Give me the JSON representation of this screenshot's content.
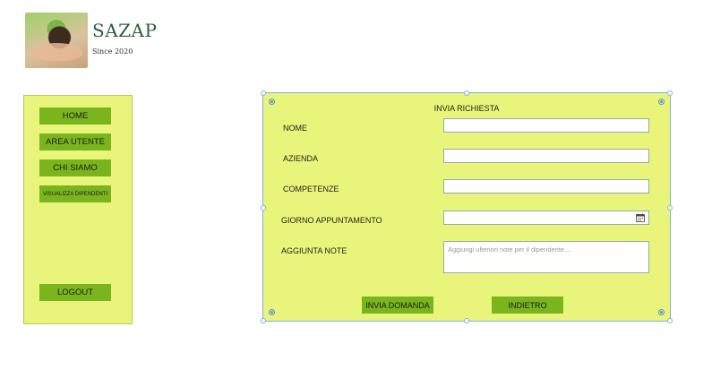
{
  "brand": {
    "name": "SAZAP",
    "since": "Since 2020"
  },
  "sidebar": {
    "items": [
      {
        "label": "HOME"
      },
      {
        "label": "AREA UTENTE"
      },
      {
        "label": "CHI SIAMO"
      },
      {
        "label": "VISUALIZZA DIPENDENTI"
      }
    ],
    "logout_label": "LOGOUT"
  },
  "form": {
    "title": "INVIA RICHIESTA",
    "fields": [
      {
        "label": "NOME",
        "value": ""
      },
      {
        "label": "AZIENDA",
        "value": ""
      },
      {
        "label": "COMPETENZE",
        "value": ""
      },
      {
        "label": "GIORNO APPUNTAMENTO",
        "value": ""
      }
    ],
    "notes": {
      "label": "AGGIUNTA NOTE",
      "placeholder": "Aggiungi ulteriori note per il dipendente....",
      "value": ""
    },
    "submit_label": "INVIA DOMANDA",
    "back_label": "INDIETRO"
  },
  "colors": {
    "panel_bg": "#e8f57a",
    "button_bg": "#7ab51d",
    "brand_text": "#2e5e3a",
    "selection_border": "#7fb0e0"
  },
  "icons": [
    "calendar-icon"
  ]
}
